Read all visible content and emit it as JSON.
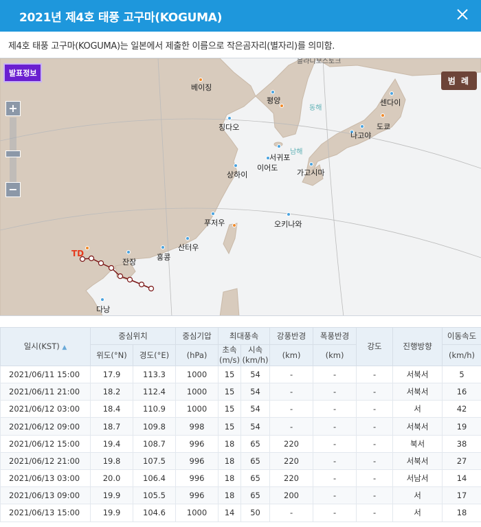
{
  "header": {
    "title": "2021년 제4호 태풍 고구마(KOGUMA)"
  },
  "description": "제4호 태풍 고구마(KOGUMA)는 일본에서 제출한 이름으로 작은곰자리(별자리)를 의미함.",
  "map": {
    "info_button": "발표정보",
    "legend_button": "범 례",
    "zoom_in": "+",
    "zoom_out": "−",
    "track_label": "TD",
    "cities": [
      "베이징",
      "평양",
      "동해",
      "센다이",
      "칭다오",
      "도쿄",
      "나고야",
      "남해",
      "서귀포",
      "이어도",
      "상하이",
      "가고시마",
      "푸저우",
      "오키나와",
      "산터우",
      "홍콩",
      "잔장",
      "다낭"
    ],
    "top_label": "블라디보스토크",
    "colors": {
      "track": "#7a1515",
      "label": "#e53a1e",
      "land": "#d8cbbd",
      "sea": "#f2f3f4"
    }
  },
  "table": {
    "headers": {
      "datetime": "일시(KST)",
      "center": "중심위치",
      "lat": "위도(°N)",
      "lon": "경도(°E)",
      "pressure": "중심기압",
      "pressure_unit": "(hPa)",
      "maxwind": "최대풍속",
      "ms": "초속",
      "ms_unit": "(m/s)",
      "kmh": "시속",
      "kmh_unit": "(km/h)",
      "strong": "강풍반경",
      "strong_unit": "(km)",
      "storm": "폭풍반경",
      "storm_unit": "(km)",
      "intensity": "강도",
      "direction": "진행방향",
      "speed": "이동속도",
      "speed_unit": "(km/h)"
    },
    "rows": [
      [
        "2021/06/11 15:00",
        "17.9",
        "113.3",
        "1000",
        "15",
        "54",
        "-",
        "-",
        "-",
        "서북서",
        "5"
      ],
      [
        "2021/06/11 21:00",
        "18.2",
        "112.4",
        "1000",
        "15",
        "54",
        "-",
        "-",
        "-",
        "서북서",
        "16"
      ],
      [
        "2021/06/12 03:00",
        "18.4",
        "110.9",
        "1000",
        "15",
        "54",
        "-",
        "-",
        "-",
        "서",
        "42"
      ],
      [
        "2021/06/12 09:00",
        "18.7",
        "109.8",
        "998",
        "15",
        "54",
        "-",
        "-",
        "-",
        "서북서",
        "19"
      ],
      [
        "2021/06/12 15:00",
        "19.4",
        "108.7",
        "996",
        "18",
        "65",
        "220",
        "-",
        "-",
        "북서",
        "38"
      ],
      [
        "2021/06/12 21:00",
        "19.8",
        "107.5",
        "996",
        "18",
        "65",
        "220",
        "-",
        "-",
        "서북서",
        "27"
      ],
      [
        "2021/06/13 03:00",
        "20.0",
        "106.4",
        "996",
        "18",
        "65",
        "220",
        "-",
        "-",
        "서남서",
        "14"
      ],
      [
        "2021/06/13 09:00",
        "19.9",
        "105.5",
        "996",
        "18",
        "65",
        "200",
        "-",
        "-",
        "서",
        "17"
      ],
      [
        "2021/06/13 15:00",
        "19.9",
        "104.6",
        "1000",
        "14",
        "50",
        "-",
        "-",
        "-",
        "서",
        "18"
      ]
    ]
  }
}
